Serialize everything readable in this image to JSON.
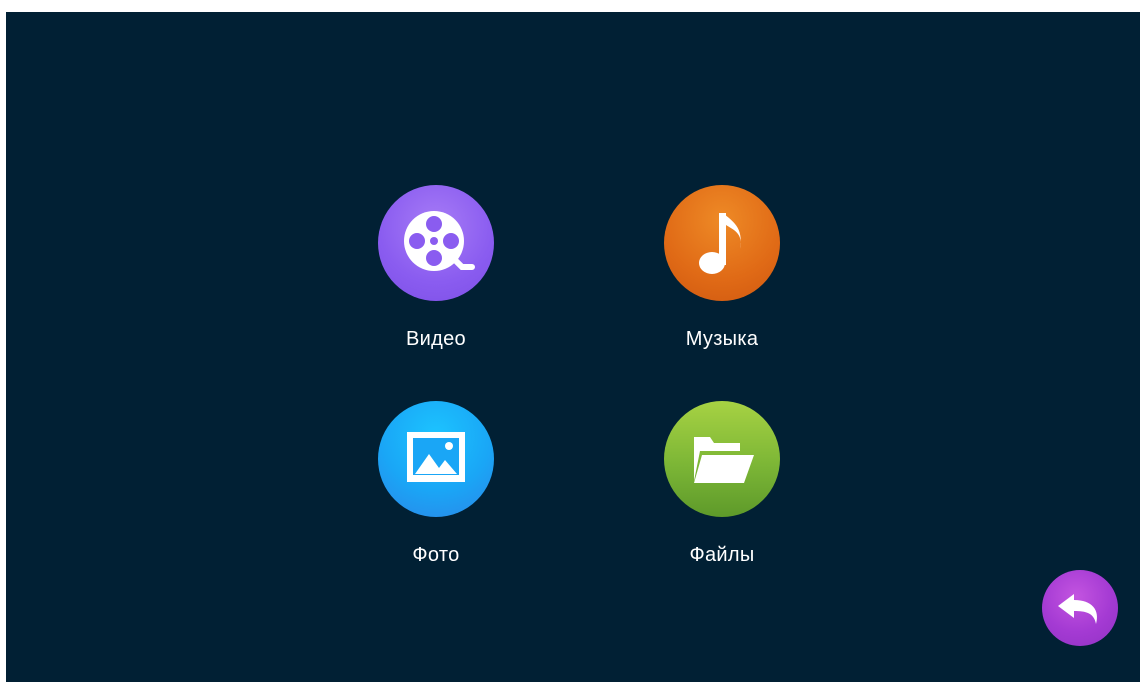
{
  "menu": {
    "video": {
      "label": "Видео",
      "icon": "film-reel-icon",
      "color": "#8a5cf0"
    },
    "music": {
      "label": "Музыка",
      "icon": "music-note-icon",
      "color": "#e06a16"
    },
    "photo": {
      "label": "Фото",
      "icon": "picture-icon",
      "color": "#1aa6f6"
    },
    "files": {
      "label": "Файлы",
      "icon": "folder-icon",
      "color": "#7cb636"
    }
  },
  "back": {
    "icon": "back-arrow-icon",
    "color": "#a43ad3"
  },
  "theme": {
    "background": "#012034",
    "text": "#ffffff"
  }
}
